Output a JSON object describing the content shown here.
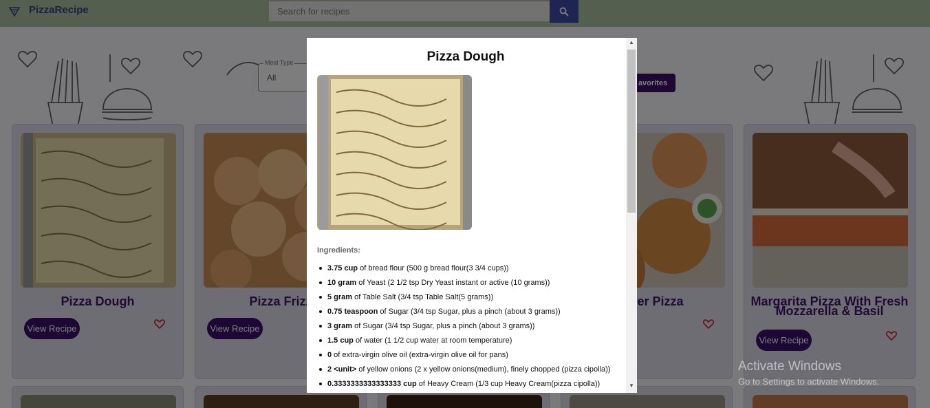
{
  "header": {
    "app_name": "PizzaRecipe",
    "search_placeholder": "Search for recipes"
  },
  "filters": {
    "meal_type_label": "Meal Type",
    "meal_type_value": "All",
    "favorites_label": "avorites"
  },
  "cards": [
    {
      "title": "Pizza Dough",
      "button": "View Recipe"
    },
    {
      "title": "Pizza Frizz",
      "button": "View Recipe"
    },
    {
      "title": "r Fryer Pizza",
      "button": ""
    },
    {
      "title": "Margarita Pizza With Fresh Mozzarella & Basil",
      "button": "View Recipe"
    }
  ],
  "modal": {
    "title": "Pizza Dough",
    "ingredients_heading": "Ingredients:",
    "ingredients": [
      {
        "qty": "3.75 cup",
        "text": " of bread flour (500 g bread flour(3 3/4 cups))"
      },
      {
        "qty": "10 gram",
        "text": " of Yeast (2 1/2 tsp Dry Yeast instant or active (10 grams))"
      },
      {
        "qty": "5 gram",
        "text": " of Table Salt (3/4 tsp Table Salt(5 grams))"
      },
      {
        "qty": "0.75 teaspoon",
        "text": " of Sugar (3/4 tsp Sugar, plus a pinch (about 3 grams))"
      },
      {
        "qty": "3 gram",
        "text": " of Sugar (3/4 tsp Sugar, plus a pinch (about 3 grams))"
      },
      {
        "qty": "1.5 cup",
        "text": " of water (1 1/2 cup water at room temperature)"
      },
      {
        "qty": "0",
        "text": " of extra-virgin olive oil (extra-virgin olive oil for pans)"
      },
      {
        "qty": "2 <unit>",
        "text": " of yellow onions (2 x yellow onions(medium), finely chopped (pizza cipolla))"
      },
      {
        "qty": "0.3333333333333333 cup",
        "text": " of Heavy Cream (1/3 cup Heavy Cream(pizza cipolla))"
      }
    ]
  },
  "system": {
    "activate_title": "Activate Windows",
    "activate_sub": "Go to Settings to activate Windows."
  },
  "colors": {
    "header_bg": "#a9bf9f",
    "accent_purple": "#3a0f6b",
    "search_button": "#3c4ba6",
    "heart_red": "#d11a2a"
  }
}
